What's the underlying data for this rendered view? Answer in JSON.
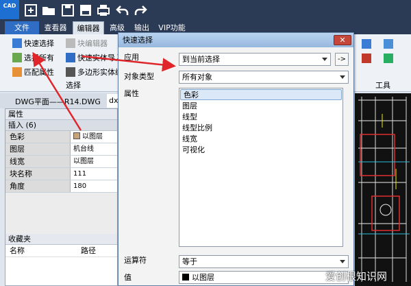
{
  "app": {
    "logo_text": "CAD"
  },
  "ribbon_tabs": [
    "文件",
    "查看器",
    "编辑器",
    "高级",
    "输出",
    "VIP功能"
  ],
  "ribbon": {
    "quick_select": "快速选择",
    "block_editor": "块编辑器",
    "select_all": "选择所有",
    "quick_entity_import": "快速实体导入",
    "match_props": "匹配属性",
    "polygon_entity": "多边形实体编",
    "group_select": "选择",
    "group_tools": "工具"
  },
  "doc_tabs": [
    "DWG平面——R14.DWG",
    "dx"
  ],
  "properties_panel": {
    "title": "属性",
    "group": "插入 (6)",
    "rows": [
      {
        "key": "色彩",
        "value": "以图层"
      },
      {
        "key": "图层",
        "value": "机台线"
      },
      {
        "key": "线宽",
        "value": "以图层"
      },
      {
        "key": "块名称",
        "value": "111"
      },
      {
        "key": "角度",
        "value": "180"
      }
    ]
  },
  "favorites_panel": {
    "title": "收藏夹",
    "col_name": "名称",
    "col_path": "路径"
  },
  "dialog": {
    "title": "快速选择",
    "close": "✕",
    "apply_label": "应用",
    "apply_value": "到当前选择",
    "apply_button": "->",
    "object_type_label": "对象类型",
    "object_type_value": "所有对象",
    "properties_label": "属性",
    "property_items": [
      "色彩",
      "图层",
      "线型",
      "线型比例",
      "线宽",
      "可视化"
    ],
    "operator_label": "运算符",
    "operator_value": "等于",
    "value_label": "值",
    "value_value": "以图层"
  },
  "watermark": "爱创根知识网",
  "colors": {
    "accent": "#2f6ec4",
    "arrow": "#e0262a"
  }
}
